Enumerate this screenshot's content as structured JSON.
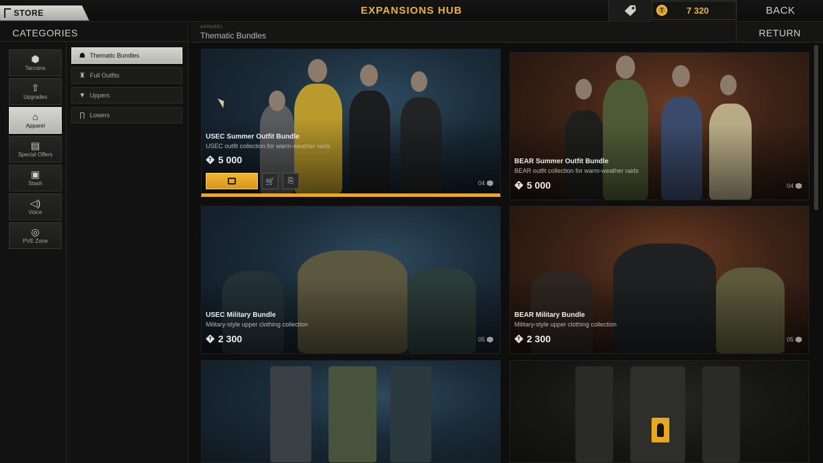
{
  "topbar": {
    "store_tab": "STORE",
    "title": "EXPANSIONS HUB",
    "balance": "7 320",
    "back": "BACK",
    "accent_color": "#e9b23a"
  },
  "sidebar": {
    "header": "CATEGORIES",
    "categories": [
      {
        "label": "Tarcoins",
        "icon": "tarcoin-icon"
      },
      {
        "label": "Upgrades",
        "icon": "upgrade-arrow-icon"
      },
      {
        "label": "Apparel",
        "icon": "hanger-icon",
        "active": true
      },
      {
        "label": "Special Offers",
        "icon": "offer-icon"
      },
      {
        "label": "Stash",
        "icon": "stash-boxes-icon"
      },
      {
        "label": "Voice",
        "icon": "speaker-icon"
      },
      {
        "label": "PVE Zone",
        "icon": "pve-target-icon"
      }
    ],
    "subcategories": [
      {
        "label": "Thematic Bundles",
        "icon": "people-icon",
        "active": true
      },
      {
        "label": "Full Outfits",
        "icon": "outfit-icon"
      },
      {
        "label": "Uppers",
        "icon": "shirt-icon"
      },
      {
        "label": "Lowers",
        "icon": "pants-icon"
      }
    ]
  },
  "main": {
    "crumb_small": "Apparel",
    "crumb_title": "Thematic Bundles",
    "return": "RETURN",
    "cards": [
      {
        "title": "USEC Summer Outfit Bundle",
        "subtitle": "USEC outfit collection for warm-weather raids",
        "price": "5 000",
        "count": "04"
      },
      {
        "title": "BEAR Summer Outfit Bundle",
        "subtitle": "BEAR outfit collection for warm-weather raids",
        "price": "5 000",
        "count": "04"
      },
      {
        "title": "USEC Military Bundle",
        "subtitle": "Military-style upper clothing collection",
        "price": "2 300",
        "count": "05"
      },
      {
        "title": "BEAR Military Bundle",
        "subtitle": "Military-style upper clothing collection",
        "price": "2 300",
        "count": "05"
      }
    ]
  }
}
